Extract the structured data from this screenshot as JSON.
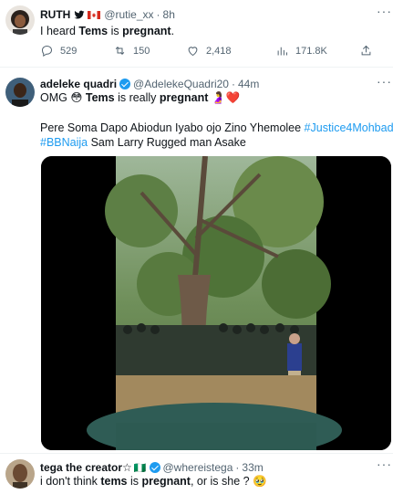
{
  "tweet1": {
    "name": "RUTH",
    "handle": "@rutie_xx",
    "time": "8h",
    "text_pre": "I heard ",
    "text_bold1": "Tems",
    "text_mid": " is ",
    "text_bold2": "pregnant",
    "text_end": ".",
    "replies": "529",
    "retweets": "150",
    "likes": "2,418",
    "views": "171.8K"
  },
  "tweet2": {
    "name": "adeleke quadri",
    "handle": "@AdelekeQuadri20",
    "time": "44m",
    "line1_pre": "OMG ",
    "line1_emoji": "😳",
    "line1_bold1": "Tems",
    "line1_mid": " is really ",
    "line1_bold2": "pregnant",
    "line1_emoji2": "🤰❤️",
    "line2_text": "Pere Soma Dapo Abiodun Iyabo ojo Zino Yhemolee ",
    "line2_hashtag": "#Justice4Mohbad",
    "line3_hashtag": "#BBNaija",
    "line3_text": " Sam Larry  Rugged man Asake"
  },
  "tweet3": {
    "name": "tega the creator☆",
    "flag": "🇳🇬",
    "handle": "@whereistega",
    "time": "33m",
    "text_pre": "i don't think ",
    "text_bold1": "tems",
    "text_mid": " is ",
    "text_bold2": "pregnant",
    "text_end": ", or is she ? ",
    "emoji": "🥹"
  },
  "colors": {
    "accent": "#1d9bf0",
    "muted": "#536471",
    "border": "#eff3f4"
  },
  "icons": [
    "more-icon",
    "reply-icon",
    "retweet-icon",
    "like-icon",
    "views-icon",
    "share-icon",
    "verified-icon",
    "twitter-bird-icon",
    "canada-flag-icon",
    "nigeria-flag-icon"
  ]
}
